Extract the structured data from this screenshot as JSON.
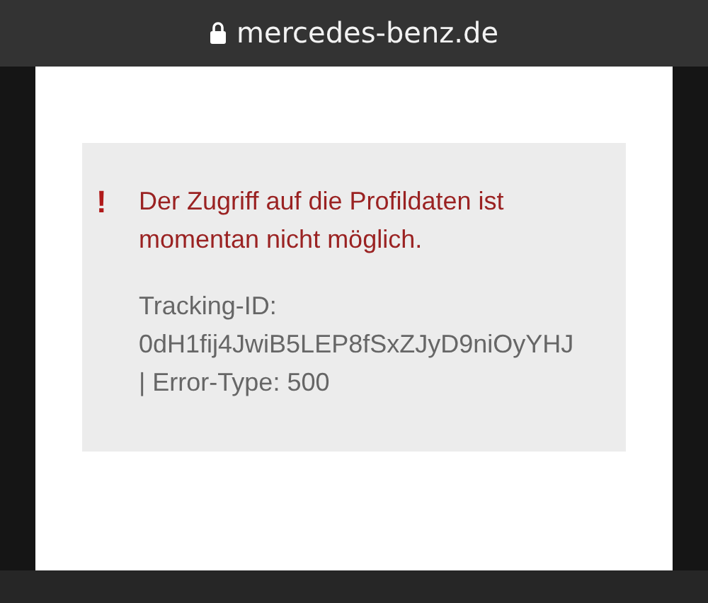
{
  "address_bar": {
    "url": "mercedes-benz.de",
    "secure": true
  },
  "error": {
    "icon": "!",
    "message": "Der Zugriff auf die Profildaten ist momentan nicht möglich.",
    "details": "Tracking-ID: 0dH1fij4JwiB5LEP8fSxZJyD9niOyYHJ | Error-Type: 500"
  }
}
